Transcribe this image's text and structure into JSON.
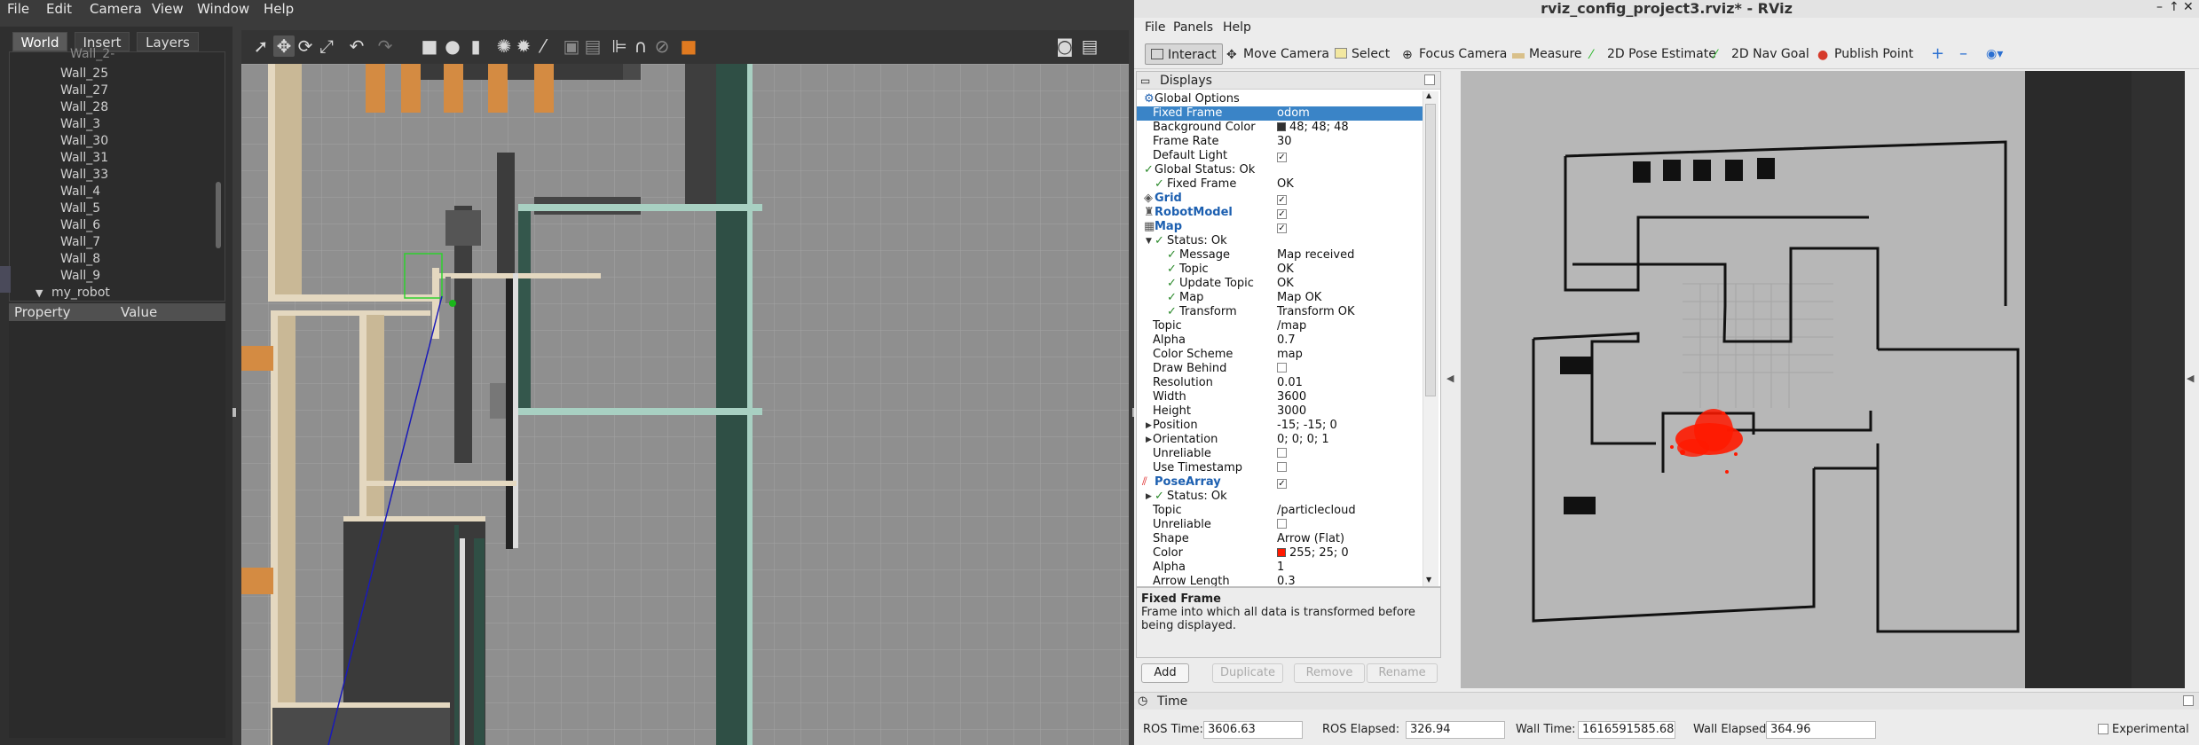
{
  "gazebo": {
    "menu": [
      "File",
      "Edit",
      "Camera",
      "View",
      "Window",
      "Help"
    ],
    "tabs": [
      "World",
      "Insert",
      "Layers"
    ],
    "tree_items": [
      "Wall_25",
      "Wall_27",
      "Wall_28",
      "Wall_3",
      "Wall_30",
      "Wall_31",
      "Wall_33",
      "Wall_4",
      "Wall_5",
      "Wall_6",
      "Wall_7",
      "Wall_8",
      "Wall_9"
    ],
    "tree_selected": "my_robot",
    "prop_header": {
      "property": "Property",
      "value": "Value"
    }
  },
  "rviz": {
    "title": "rviz_config_project3.rviz* - RViz",
    "menu": [
      "File",
      "Panels",
      "Help"
    ],
    "toolbar": {
      "interact": "Interact",
      "move_camera": "Move Camera",
      "select": "Select",
      "focus_camera": "Focus Camera",
      "measure": "Measure",
      "pose_estimate": "2D Pose Estimate",
      "nav_goal": "2D Nav Goal",
      "publish_point": "Publish Point"
    },
    "displays_title": "Displays",
    "tree": {
      "global_options": "Global Options",
      "fixed_frame": {
        "name": "Fixed Frame",
        "value": "odom"
      },
      "background_color": {
        "name": "Background Color",
        "value": "48; 48; 48",
        "color": "#303030"
      },
      "frame_rate": {
        "name": "Frame Rate",
        "value": "30"
      },
      "default_light": {
        "name": "Default Light"
      },
      "global_status": "Global Status: Ok",
      "gs_fixed_frame": {
        "name": "Fixed Frame",
        "value": "OK"
      },
      "grid": "Grid",
      "robot_model": "RobotModel",
      "map": "Map",
      "map_status": "Status: Ok",
      "message": {
        "name": "Message",
        "value": "Map received"
      },
      "topic_ok": {
        "name": "Topic",
        "value": "OK"
      },
      "update_topic": {
        "name": "Update Topic",
        "value": "OK"
      },
      "map_ok": {
        "name": "Map",
        "value": "Map OK"
      },
      "transform": {
        "name": "Transform",
        "value": "Transform OK"
      },
      "topic": {
        "name": "Topic",
        "value": "/map"
      },
      "alpha": {
        "name": "Alpha",
        "value": "0.7"
      },
      "color_scheme": {
        "name": "Color Scheme",
        "value": "map"
      },
      "draw_behind": {
        "name": "Draw Behind"
      },
      "resolution": {
        "name": "Resolution",
        "value": "0.01"
      },
      "width": {
        "name": "Width",
        "value": "3600"
      },
      "height": {
        "name": "Height",
        "value": "3000"
      },
      "position": {
        "name": "Position",
        "value": "-15; -15; 0"
      },
      "orientation": {
        "name": "Orientation",
        "value": "0; 0; 0; 1"
      },
      "unreliable": {
        "name": "Unreliable"
      },
      "use_timestamp": {
        "name": "Use Timestamp"
      },
      "pose_array": "PoseArray",
      "pa_status": "Status: Ok",
      "pa_topic": {
        "name": "Topic",
        "value": "/particlecloud"
      },
      "pa_unreliable": {
        "name": "Unreliable"
      },
      "shape": {
        "name": "Shape",
        "value": "Arrow (Flat)"
      },
      "pa_color": {
        "name": "Color",
        "value": "255; 25; 0",
        "color": "#ff1900"
      },
      "pa_alpha": {
        "name": "Alpha",
        "value": "1"
      },
      "arrow_length": {
        "name": "Arrow Length",
        "value": "0.3"
      }
    },
    "description": {
      "title": "Fixed Frame",
      "text": "Frame into which all data is transformed before being displayed."
    },
    "buttons": {
      "add": "Add",
      "duplicate": "Duplicate",
      "remove": "Remove",
      "rename": "Rename"
    },
    "time_title": "Time",
    "status": {
      "ros_time_label": "ROS Time:",
      "ros_time": "3606.63",
      "ros_elapsed_label": "ROS Elapsed:",
      "ros_elapsed": "326.94",
      "wall_time_label": "Wall Time:",
      "wall_time": "1616591585.68",
      "wall_elapsed_label": "Wall Elapsed:",
      "wall_elapsed": "364.96",
      "experimental": "Experimental"
    }
  }
}
